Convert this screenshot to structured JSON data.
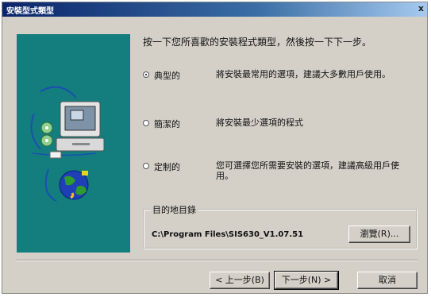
{
  "window": {
    "title": "安裝型式類型",
    "close_glyph": "x"
  },
  "instruction": "按一下您所喜歡的安裝程式類型，然後按一下下一步。",
  "options": [
    {
      "label": "典型的",
      "description": "將安裝最常用的選項，建議大多數用戶使用。",
      "selected": true
    },
    {
      "label": "簡潔的",
      "description": "將安裝最少選項的程式",
      "selected": false
    },
    {
      "label": "定制的",
      "description": "您可選擇您所需要安裝的選項，建議高級用戶使用。",
      "selected": false
    }
  ],
  "destination": {
    "legend": "目的地目錄",
    "path": "C:\\Program Files\\SIS630_V1.07.51",
    "browse_label": "瀏覽(R)..."
  },
  "buttons": {
    "back": "< 上一步(B)",
    "next": "下一步(N) >",
    "cancel": "取消"
  },
  "colors": {
    "panel": "#147e7e",
    "dialog": "#d4d0c8",
    "titlebar": "#0a246a"
  }
}
